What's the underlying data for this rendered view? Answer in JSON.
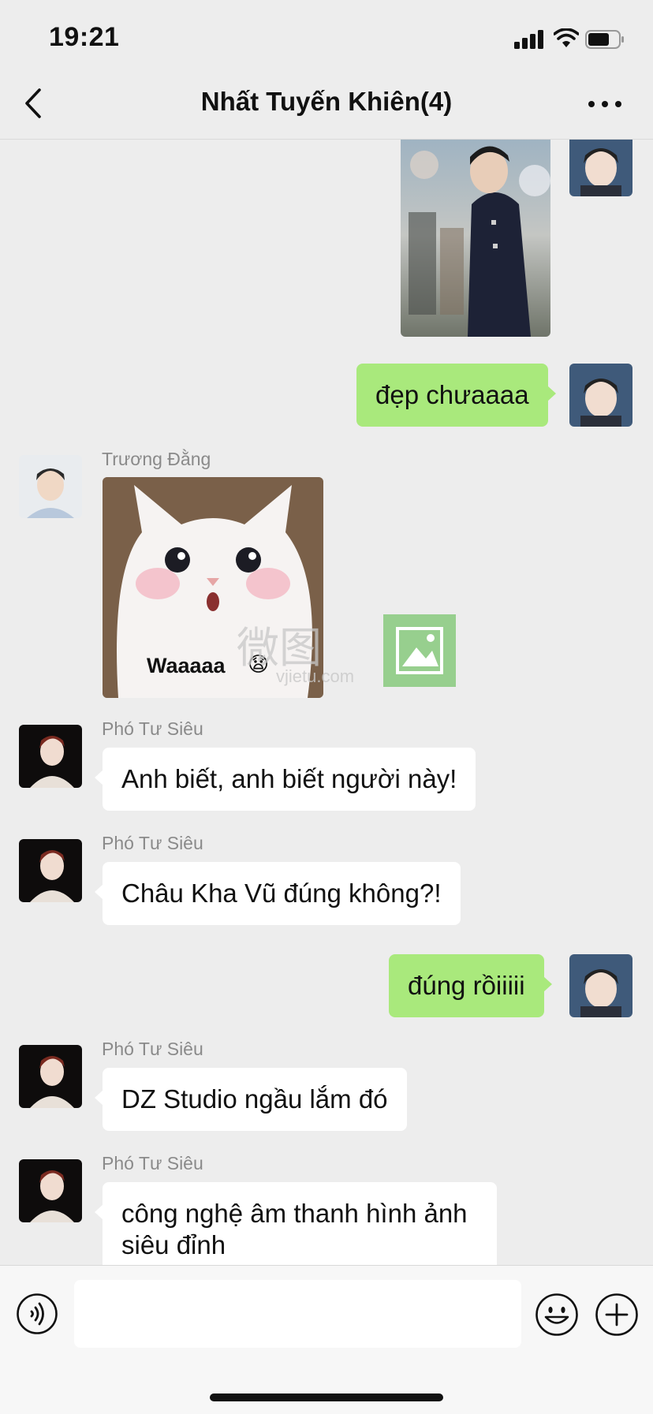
{
  "status_bar": {
    "time": "19:21"
  },
  "header": {
    "title": "Nhất Tuyến Khiên(4)"
  },
  "messages": [
    {
      "kind": "image",
      "side": "out",
      "image_desc": "photo-of-man-in-navy-suit"
    },
    {
      "kind": "text",
      "side": "out",
      "text": "đẹp chưaaaa"
    },
    {
      "kind": "sticker",
      "side": "in",
      "sender": "Trương Đằng",
      "caption": "Waaaaa",
      "watermark": "微图",
      "watermark_url": "vjietu.com"
    },
    {
      "kind": "text",
      "side": "in",
      "sender": "Phó Tư Siêu",
      "text": "Anh biết, anh biết người này!"
    },
    {
      "kind": "text",
      "side": "in",
      "sender": "Phó Tư Siêu",
      "text": "Châu Kha Vũ đúng không?!"
    },
    {
      "kind": "text",
      "side": "out",
      "text": "đúng rồiiiii"
    },
    {
      "kind": "text",
      "side": "in",
      "sender": "Phó Tư Siêu",
      "text": "DZ Studio ngầu lắm đó"
    },
    {
      "kind": "text",
      "side": "in",
      "sender": "Phó Tư Siêu",
      "text": "công nghệ âm thanh hình ảnh siêu đỉnh"
    }
  ],
  "input": {
    "value": "",
    "placeholder": ""
  },
  "icons": {
    "back": "chevron-left-icon",
    "more": "more-dots-icon",
    "voice": "voice-icon",
    "emoji": "emoji-icon",
    "plus": "plus-icon"
  },
  "colors": {
    "background": "#ededed",
    "outgoing_bubble": "#a9e97c",
    "incoming_bubble": "#ffffff",
    "name_text": "#8a8a8a"
  }
}
